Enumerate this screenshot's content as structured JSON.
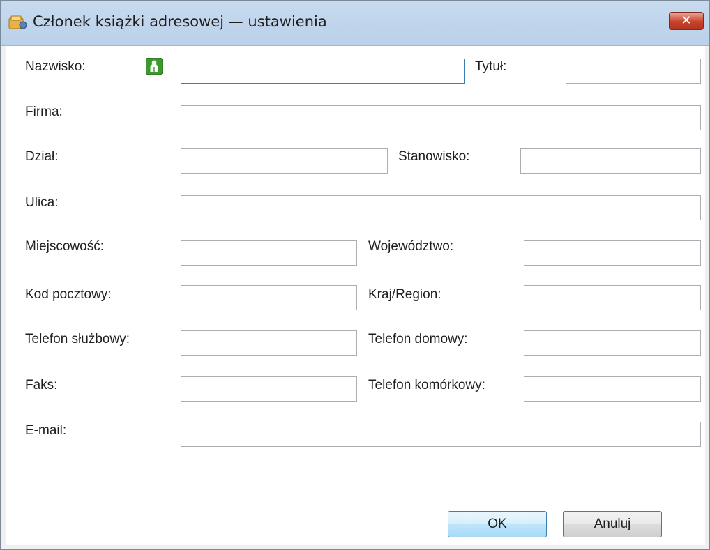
{
  "window": {
    "title": "Członek książki adresowej — ustawienia",
    "icons": {
      "title_icon": "address-book-icon",
      "close_icon": "close-icon",
      "close_glyph": "✕"
    }
  },
  "form": {
    "name_icon": "person-icon",
    "labels": {
      "last_name": "Nazwisko:",
      "title": "Tytuł:",
      "company": "Firma:",
      "department": "Dział:",
      "position": "Stanowisko:",
      "street": "Ulica:",
      "city": "Miejscowość:",
      "province": "Województwo:",
      "postal_code": "Kod pocztowy:",
      "country": "Kraj/Region:",
      "work_phone": "Telefon służbowy:",
      "home_phone": "Telefon domowy:",
      "fax": "Faks:",
      "mobile_phone": "Telefon komórkowy:",
      "email": "E-mail:"
    },
    "values": {
      "last_name": "",
      "title": "",
      "company": "",
      "department": "",
      "position": "",
      "street": "",
      "city": "",
      "province": "",
      "postal_code": "",
      "country": "",
      "work_phone": "",
      "home_phone": "",
      "fax": "",
      "mobile_phone": "",
      "email": ""
    }
  },
  "buttons": {
    "ok": "OK",
    "cancel": "Anuluj"
  },
  "colors": {
    "focus_border": "#3c7fb1",
    "title_bar": "#b9d1ea",
    "close_button": "#c8412a",
    "person_icon": "#3a9a2a"
  }
}
